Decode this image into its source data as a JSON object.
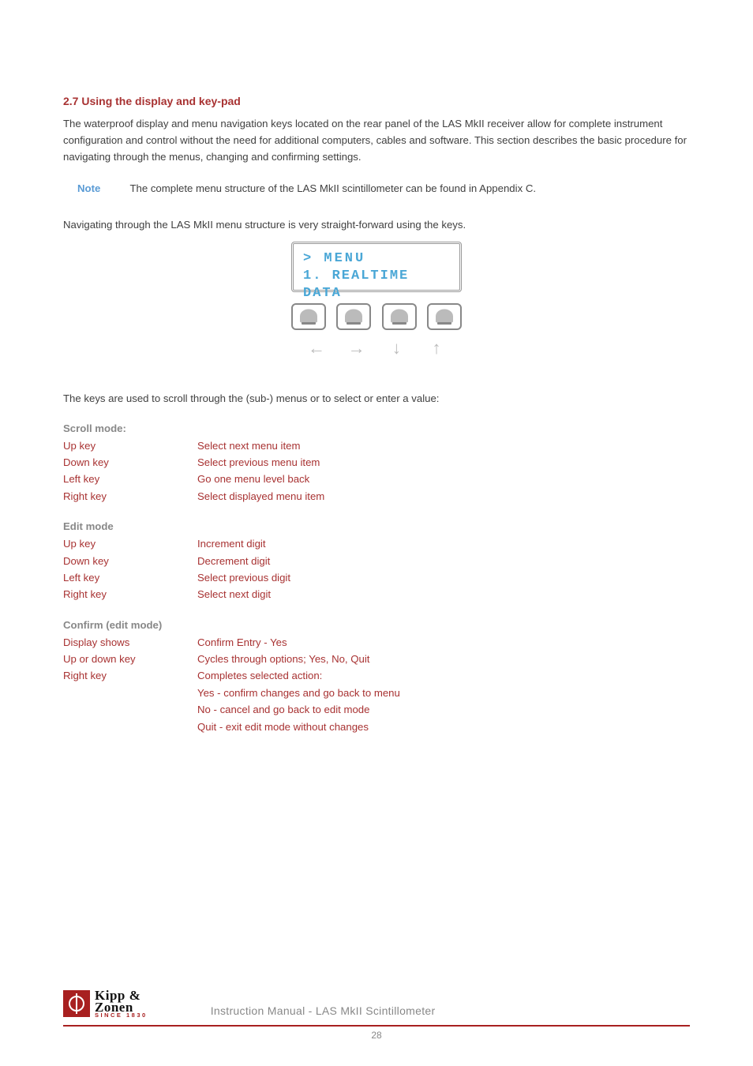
{
  "heading": "2.7 Using the display and key-pad",
  "intro": "The waterproof display and menu navigation keys located on the rear panel of the LAS MkII receiver allow for complete instrument configuration and control without the need for additional computers, cables and software. This section describes the basic procedure for navigating through the menus, changing and confirming settings.",
  "note": {
    "label": "Note",
    "text": "The complete menu structure of the LAS MkII scintillometer can be found in Appendix C."
  },
  "nav_text": "Navigating through the LAS MkII menu structure is very straight-forward using the keys.",
  "lcd": {
    "line1": "> MENU",
    "line2": "1. REALTIME DATA"
  },
  "arrows": {
    "left": "←",
    "right": "→",
    "down": "↓",
    "up": "↑"
  },
  "keys_intro": "The keys are used to scroll through the (sub-) menus or to select or enter a value:",
  "scroll": {
    "heading": "Scroll mode:",
    "rows": [
      {
        "k": "Up key",
        "v": "Select next menu item"
      },
      {
        "k": "Down key",
        "v": "Select previous menu item"
      },
      {
        "k": "Left key",
        "v": "Go one menu level back"
      },
      {
        "k": "Right key",
        "v": "Select displayed menu item"
      }
    ]
  },
  "edit": {
    "heading": "Edit mode",
    "rows": [
      {
        "k": "Up key",
        "v": "Increment digit"
      },
      {
        "k": "Down key",
        "v": "Decrement digit"
      },
      {
        "k": "Left key",
        "v": "Select previous digit"
      },
      {
        "k": "Right key",
        "v": "Select next digit"
      }
    ]
  },
  "confirm": {
    "heading": "Confirm (edit mode)",
    "rows": [
      {
        "k": "Display shows",
        "v": "Confirm Entry - Yes"
      },
      {
        "k": "Up or down key",
        "v": "Cycles through options; Yes, No, Quit"
      },
      {
        "k": "Right key",
        "v": "Completes selected action:"
      },
      {
        "k": "",
        "v": "Yes - confirm changes and go back to menu"
      },
      {
        "k": "",
        "v": "No - cancel and go back to edit mode"
      },
      {
        "k": "",
        "v": "Quit - exit edit mode without changes"
      }
    ]
  },
  "footer": {
    "logo_line1": "Kipp &",
    "logo_line2": "Zonen",
    "since": "SINCE 1830",
    "doc_title": "Instruction Manual - LAS MkII Scintillometer",
    "page": "28"
  }
}
